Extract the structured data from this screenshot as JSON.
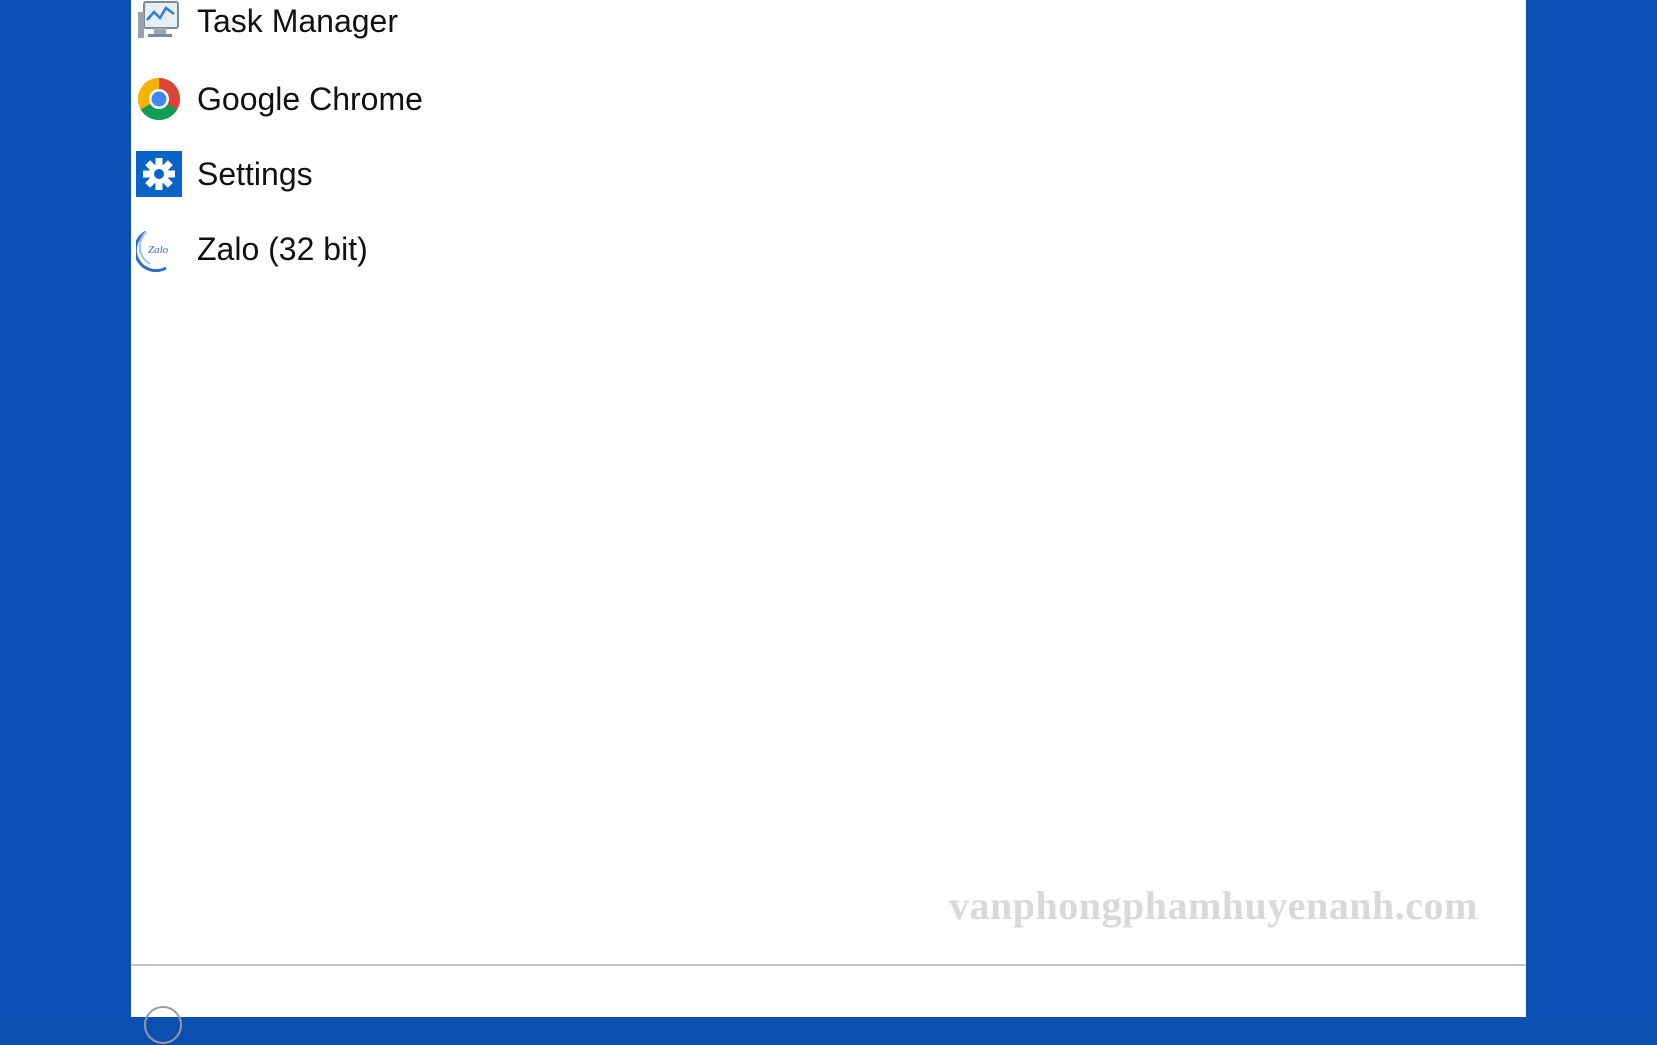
{
  "start_menu": {
    "apps": [
      {
        "label": "Task Manager",
        "icon": "task-manager-icon"
      },
      {
        "label": "Google Chrome",
        "icon": "chrome-icon"
      },
      {
        "label": "Settings",
        "icon": "settings-gear-icon"
      },
      {
        "label": "Zalo (32 bit)",
        "icon": "zalo-icon"
      }
    ]
  },
  "watermark": "vanphongphamhuyenanh.com",
  "colors": {
    "desktop": "#0a4fb4",
    "panel": "#ffffff",
    "settings_tile": "#0a64c8"
  }
}
